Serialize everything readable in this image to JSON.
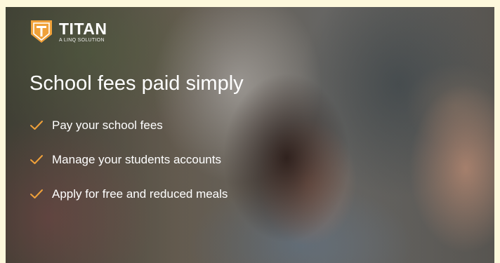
{
  "brand": {
    "name": "TITAN",
    "tagline": "A LINQ SOLUTION",
    "accent_color": "#f0a13a"
  },
  "hero": {
    "headline": "School fees paid simply",
    "features": [
      {
        "icon": "check-icon",
        "label": "Pay your school fees"
      },
      {
        "icon": "check-icon",
        "label": "Manage your students accounts"
      },
      {
        "icon": "check-icon",
        "label": "Apply for free and reduced meals"
      }
    ]
  }
}
